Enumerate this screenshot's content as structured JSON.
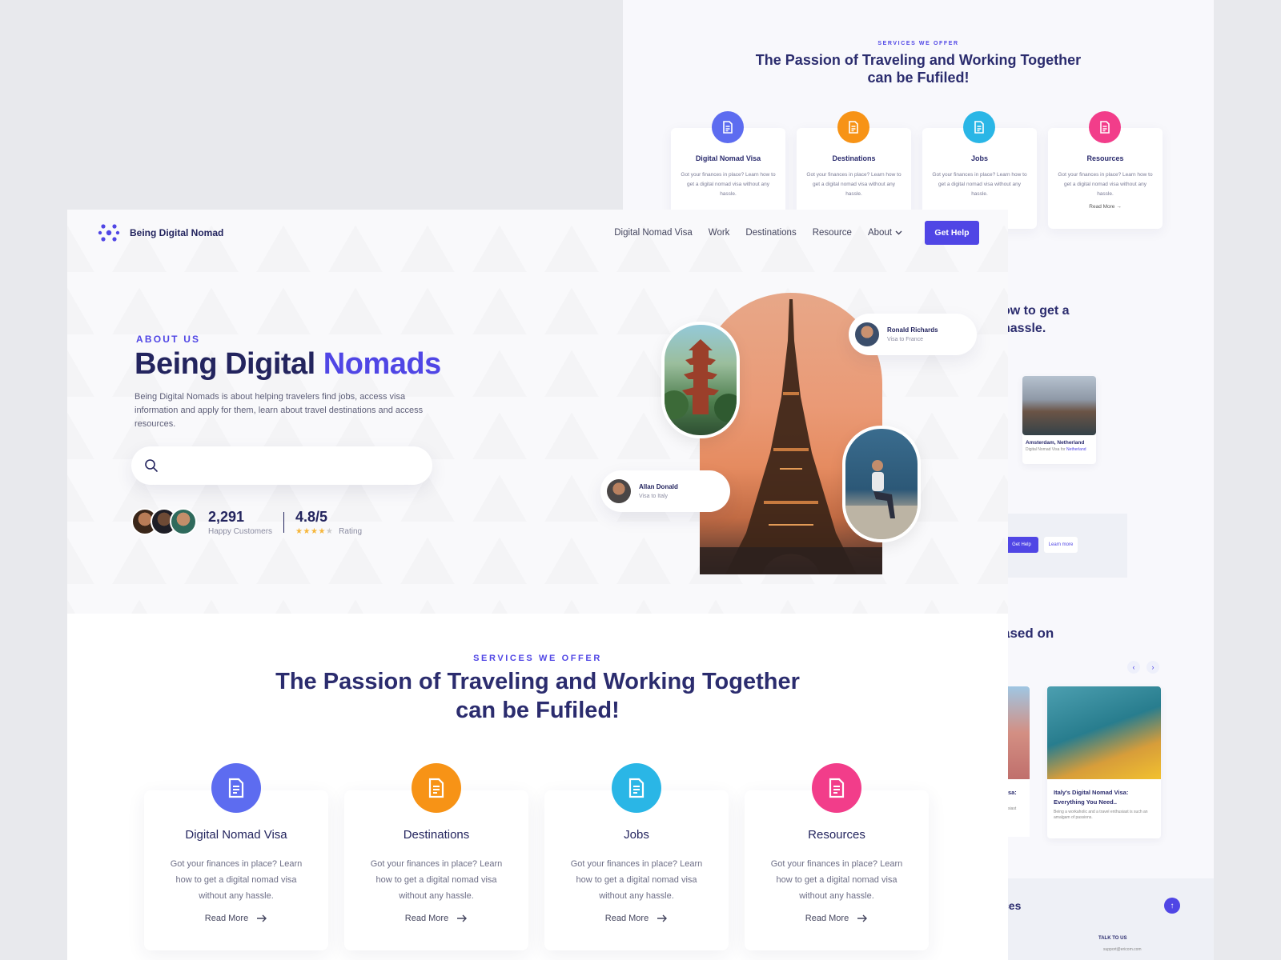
{
  "back_page": {
    "services_eyebrow": "SERVICES WE OFFER",
    "services_title": "The Passion of Traveling and Working Together can be Fufiled!",
    "cards": [
      {
        "title": "Digital Nomad Visa",
        "desc": "Got your finances in place? Learn how to get a digital nomad visa without any hassle.",
        "color": "#5d6cf0",
        "icon": "document-icon"
      },
      {
        "title": "Destinations",
        "desc": "Got your finances in place? Learn how to get a digital nomad visa without any hassle.",
        "color": "#f79316",
        "icon": "document-icon"
      },
      {
        "title": "Jobs",
        "desc": "Got your finances in place? Learn how to get a digital nomad visa without any hassle.",
        "color": "#2ab6e6",
        "icon": "document-icon"
      },
      {
        "title": "Resources",
        "desc": "Got your finances in place? Learn how to get a digital nomad visa without any hassle.",
        "read_more": "Read More",
        "color": "#f23d8a",
        "icon": "document-icon"
      }
    ],
    "partial_heading_1_line1": "ow to get a",
    "partial_heading_1_line2": "hassle.",
    "destination": {
      "name": "Amsterdam, Netherland",
      "sub_prefix": "Digital Nomad Visa for",
      "sub_link": "Netherland"
    },
    "cta": {
      "get_help": "Get Help",
      "learn_more": "Learn more"
    },
    "partial_heading_2": "ased on",
    "blog_1": {
      "title_line1": "Visa:",
      "title_line2": "..",
      "sub": "thusiast"
    },
    "blog_2": {
      "title": "Italy's Digital Nomad Visa: Everything You Need..",
      "sub": "Being a workaholic and a travel enthusiast is such an amalgam of passions."
    },
    "footer": {
      "partial_heading": "ces",
      "talk": "TALK TO US",
      "email": "support@ericom.com"
    }
  },
  "nav": {
    "brand": "Being Digital Nomad",
    "items": [
      "Digital Nomad Visa",
      "Work",
      "Destinations",
      "Resource",
      "About"
    ],
    "cta": "Get Help"
  },
  "hero": {
    "eyebrow": "ABOUT US",
    "title_main": "Being Digital ",
    "title_accent": "Nomads",
    "description": "Being Digital Nomads is about helping travelers find jobs, access visa information and apply for them, learn about travel destinations and access resources.",
    "search_placeholder": "",
    "customers_count": "2,291",
    "customers_label": "Happy Customers",
    "rating": "4.8/5",
    "rating_label": "Rating",
    "stars_filled": 4,
    "stars_total": 5,
    "testimonials": [
      {
        "name": "Ronald Richards",
        "sub": "Visa to France"
      },
      {
        "name": "Allan Donald",
        "sub": "Visa to Italy"
      }
    ]
  },
  "services": {
    "eyebrow": "SERVICES WE OFFER",
    "title_line1": "The Passion of Traveling and Working Together",
    "title_line2": "can be Fufiled!",
    "cards": [
      {
        "title": "Digital Nomad Visa",
        "desc": "Got your finances in place? Learn how to get a digital nomad visa without any hassle.",
        "read_more": "Read More",
        "color": "#5d6cf0",
        "icon": "document-icon"
      },
      {
        "title": "Destinations",
        "desc": "Got your finances in place? Learn how to get a digital nomad visa without any hassle.",
        "read_more": "Read More",
        "color": "#f79316",
        "icon": "document-icon"
      },
      {
        "title": "Jobs",
        "desc": "Got your finances in place? Learn how to get a digital nomad visa without any hassle.",
        "read_more": "Read More",
        "color": "#2ab6e6",
        "icon": "document-icon"
      },
      {
        "title": "Resources",
        "desc": "Got your finances in place? Learn how to get a digital nomad visa without any hassle.",
        "read_more": "Read More",
        "color": "#f23d8a",
        "icon": "document-icon"
      }
    ]
  },
  "colors": {
    "accent": "#5046e5",
    "heading": "#23245e",
    "star": "#f6b63b"
  }
}
